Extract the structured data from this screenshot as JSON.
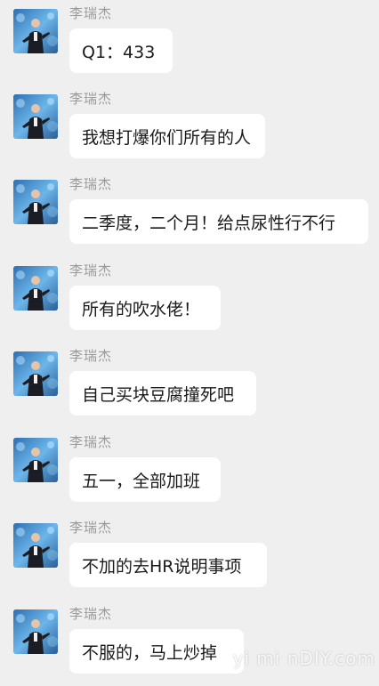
{
  "sender_name": "李瑞杰",
  "messages": [
    {
      "text": "Q1：433"
    },
    {
      "text": "我想打爆你们所有的人"
    },
    {
      "text": "二季度，二个月！给点尿性行不行"
    },
    {
      "text": "所有的吹水佬！"
    },
    {
      "text": "自己买块豆腐撞死吧"
    },
    {
      "text": "五一，全部加班"
    },
    {
      "text": "不加的去HR说明事项"
    },
    {
      "text": "不服的，马上炒掉"
    }
  ],
  "watermark": "yi mi nDIY.com",
  "colors": {
    "background": "#efefef",
    "bubble": "#ffffff",
    "sender": "#9a9a9a",
    "text": "#1a1a1a"
  }
}
